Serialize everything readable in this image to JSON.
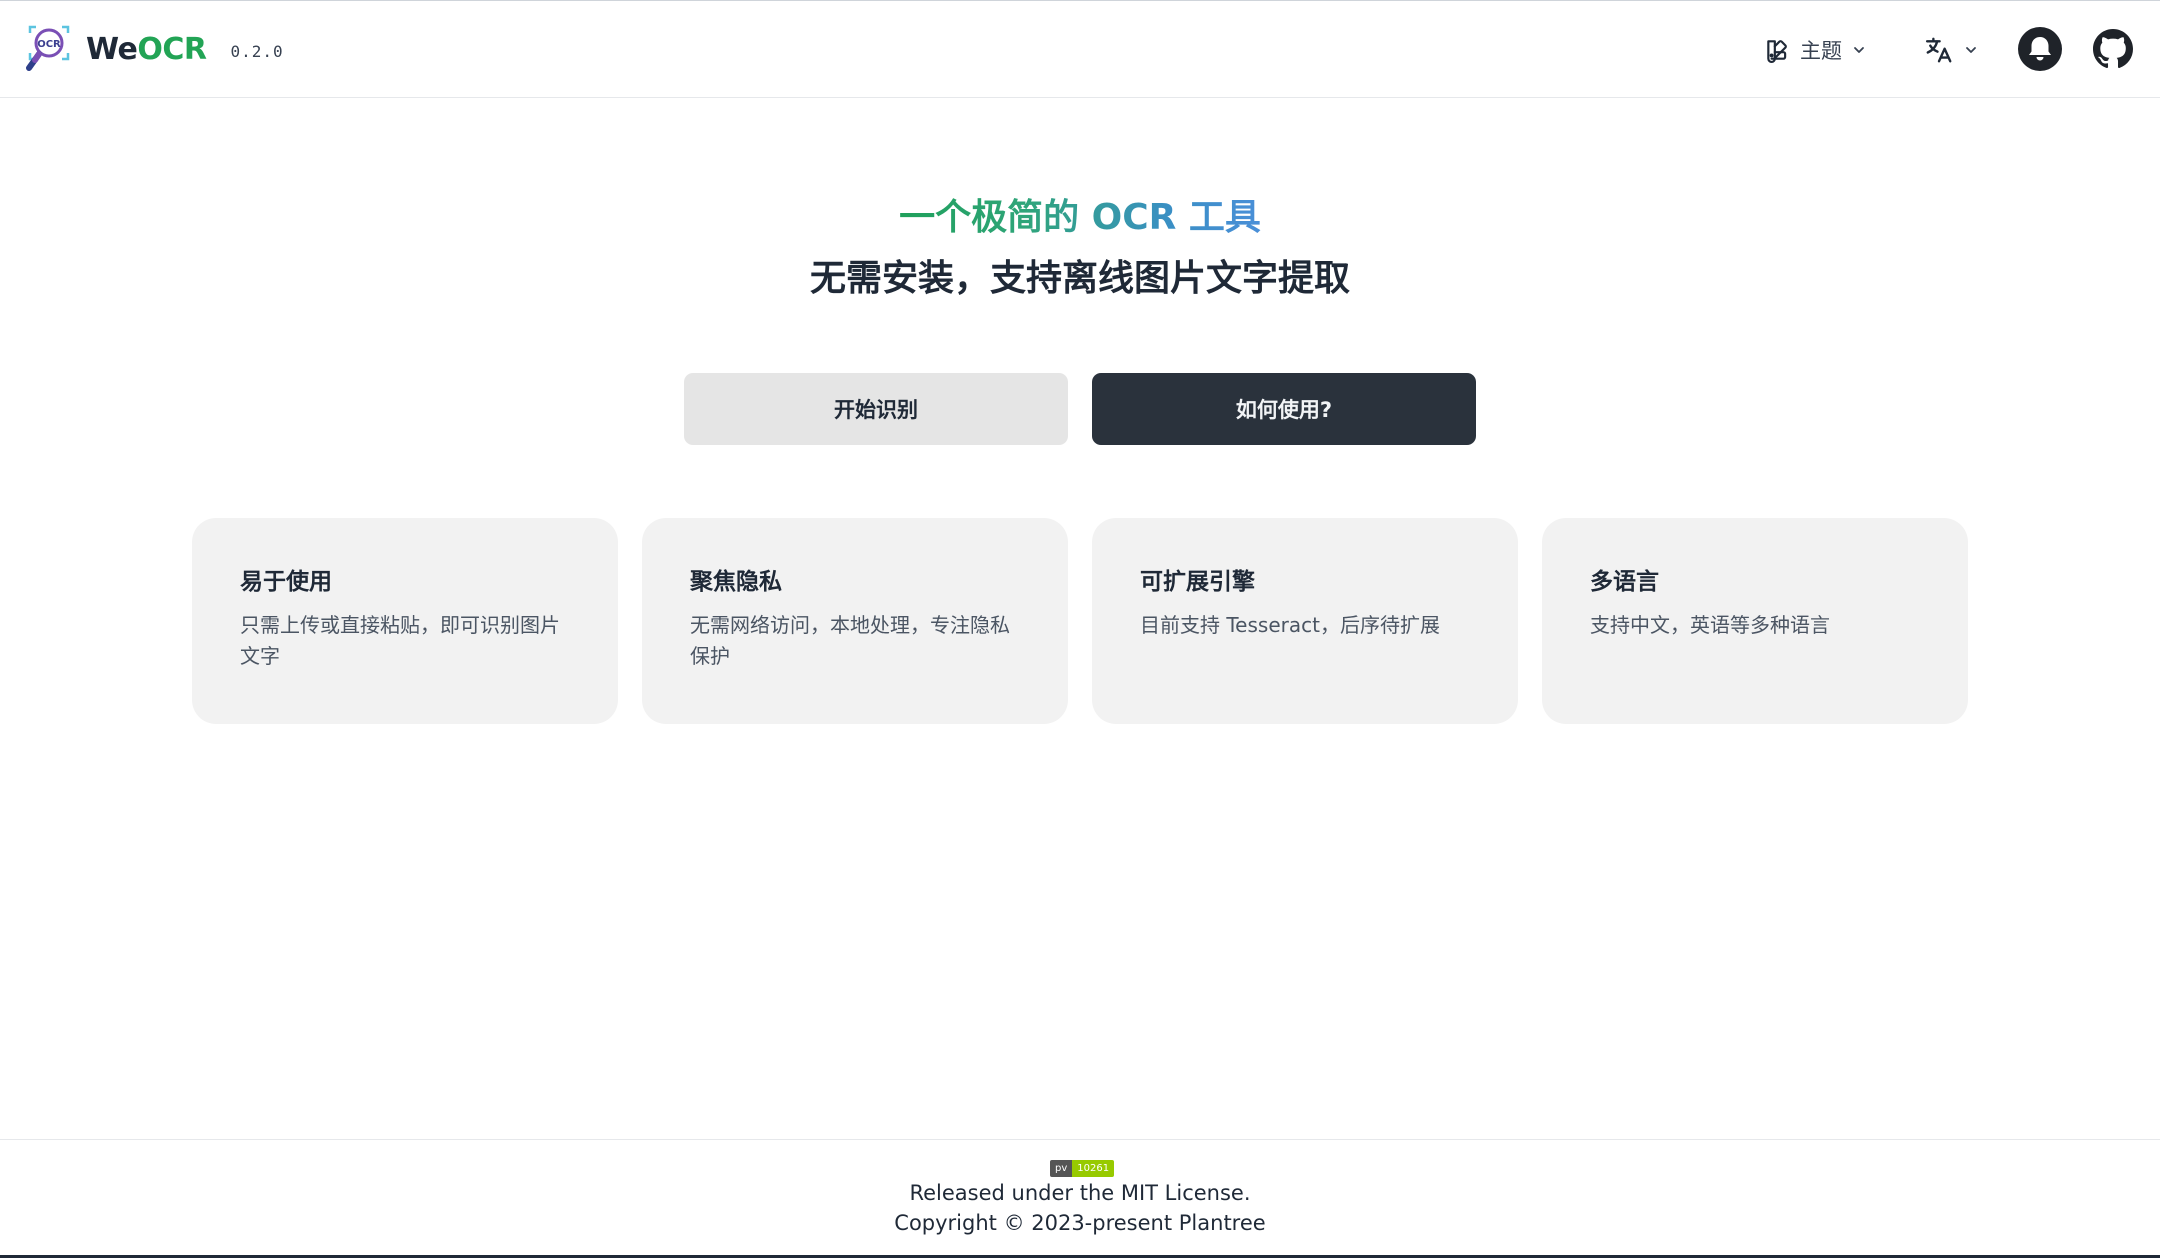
{
  "header": {
    "brand_prefix": "We",
    "brand_accent": "OCR",
    "version": "0.2.0",
    "theme_label": "主题",
    "logo_text": "OCR",
    "icons": {
      "logo": "ocr-magnifier-logo",
      "theme": "palette-icon",
      "language": "translate-icon",
      "notifications": "bell-icon",
      "github": "github-icon",
      "dropdown": "chevron-down-icon"
    }
  },
  "hero": {
    "title": "一个极简的 OCR 工具",
    "subtitle": "无需安装，支持离线图片文字提取",
    "start_button": "开始识别",
    "howto_button": "如何使用?"
  },
  "features": [
    {
      "title": "易于使用",
      "desc": "只需上传或直接粘贴，即可识别图片文字"
    },
    {
      "title": "聚焦隐私",
      "desc": "无需网络访问，本地处理，专注隐私保护"
    },
    {
      "title": "可扩展引擎",
      "desc": "目前支持 Tesseract，后序待扩展"
    },
    {
      "title": "多语言",
      "desc": "支持中文，英语等多种语言"
    }
  ],
  "footer": {
    "pv_label": "pv",
    "pv_count": "10261",
    "license": "Released under the MIT License.",
    "copyright": "Copyright © 2023-present Plantree"
  },
  "colors": {
    "brand_green": "#22a455",
    "gradient_start": "#1fa05a",
    "gradient_end": "#4a8fd8",
    "primary_dark": "#2a323c",
    "card_bg": "#f2f2f2",
    "badge_green": "#97ca00"
  }
}
